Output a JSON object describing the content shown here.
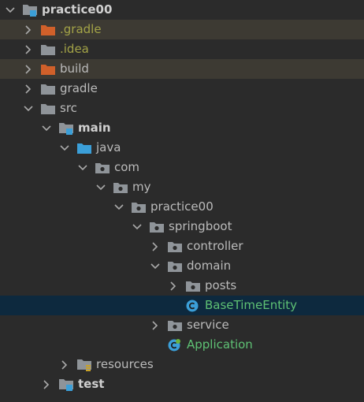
{
  "colors": {
    "background": "#2b2b2b",
    "ignored_row": "#3d3a33",
    "selected_row": "#0d293e",
    "folder_grey": "#8f9499",
    "folder_orange": "#d0602a",
    "module_blue": "#3b9fd8",
    "class_blue": "#3b9fd8",
    "ignored_text": "#a3a347",
    "class_text": "#5ec174"
  },
  "tree": [
    {
      "id": "r0",
      "label": "practice00",
      "icon": "module-folder-icon",
      "arrow": "expanded",
      "depth": 0,
      "style": "bold"
    },
    {
      "id": "r1",
      "label": ".gradle",
      "icon": "excluded-folder-icon",
      "arrow": "collapsed",
      "depth": 1,
      "style": "olive",
      "row": "ignored"
    },
    {
      "id": "r2",
      "label": ".idea",
      "icon": "folder-icon",
      "arrow": "collapsed",
      "depth": 1,
      "style": "olive"
    },
    {
      "id": "r3",
      "label": "build",
      "icon": "excluded-folder-icon",
      "arrow": "collapsed",
      "depth": 1,
      "style": "normal",
      "row": "ignored"
    },
    {
      "id": "r4",
      "label": "gradle",
      "icon": "folder-icon",
      "arrow": "collapsed",
      "depth": 1,
      "style": "normal"
    },
    {
      "id": "r5",
      "label": "src",
      "icon": "folder-icon",
      "arrow": "expanded",
      "depth": 1,
      "style": "normal"
    },
    {
      "id": "r6",
      "label": "main",
      "icon": "module-folder-icon",
      "arrow": "expanded",
      "depth": 2,
      "style": "bold"
    },
    {
      "id": "r7",
      "label": "java",
      "icon": "source-folder-icon",
      "arrow": "expanded",
      "depth": 3,
      "style": "normal"
    },
    {
      "id": "r8",
      "label": "com",
      "icon": "package-icon",
      "arrow": "expanded",
      "depth": 4,
      "style": "normal"
    },
    {
      "id": "r9",
      "label": "my",
      "icon": "package-icon",
      "arrow": "expanded",
      "depth": 5,
      "style": "normal"
    },
    {
      "id": "r10",
      "label": "practice00",
      "icon": "package-icon",
      "arrow": "expanded",
      "depth": 6,
      "style": "normal"
    },
    {
      "id": "r11",
      "label": "springboot",
      "icon": "package-icon",
      "arrow": "expanded",
      "depth": 7,
      "style": "normal"
    },
    {
      "id": "r12",
      "label": "controller",
      "icon": "package-icon",
      "arrow": "collapsed",
      "depth": 8,
      "style": "normal"
    },
    {
      "id": "r13",
      "label": "domain",
      "icon": "package-icon",
      "arrow": "expanded",
      "depth": 8,
      "style": "normal"
    },
    {
      "id": "r14",
      "label": "posts",
      "icon": "package-icon",
      "arrow": "collapsed",
      "depth": 9,
      "style": "normal"
    },
    {
      "id": "r15",
      "label": "BaseTimeEntity",
      "icon": "class-icon",
      "arrow": "none",
      "depth": 9,
      "style": "green",
      "row": "selected"
    },
    {
      "id": "r16",
      "label": "service",
      "icon": "package-icon",
      "arrow": "collapsed",
      "depth": 8,
      "style": "normal"
    },
    {
      "id": "r17",
      "label": "Application",
      "icon": "spring-class-icon",
      "arrow": "none",
      "depth": 8,
      "style": "green"
    },
    {
      "id": "r18",
      "label": "resources",
      "icon": "resources-folder-icon",
      "arrow": "collapsed",
      "depth": 3,
      "style": "normal"
    },
    {
      "id": "r19",
      "label": "test",
      "icon": "module-folder-icon",
      "arrow": "collapsed",
      "depth": 2,
      "style": "bold"
    }
  ]
}
